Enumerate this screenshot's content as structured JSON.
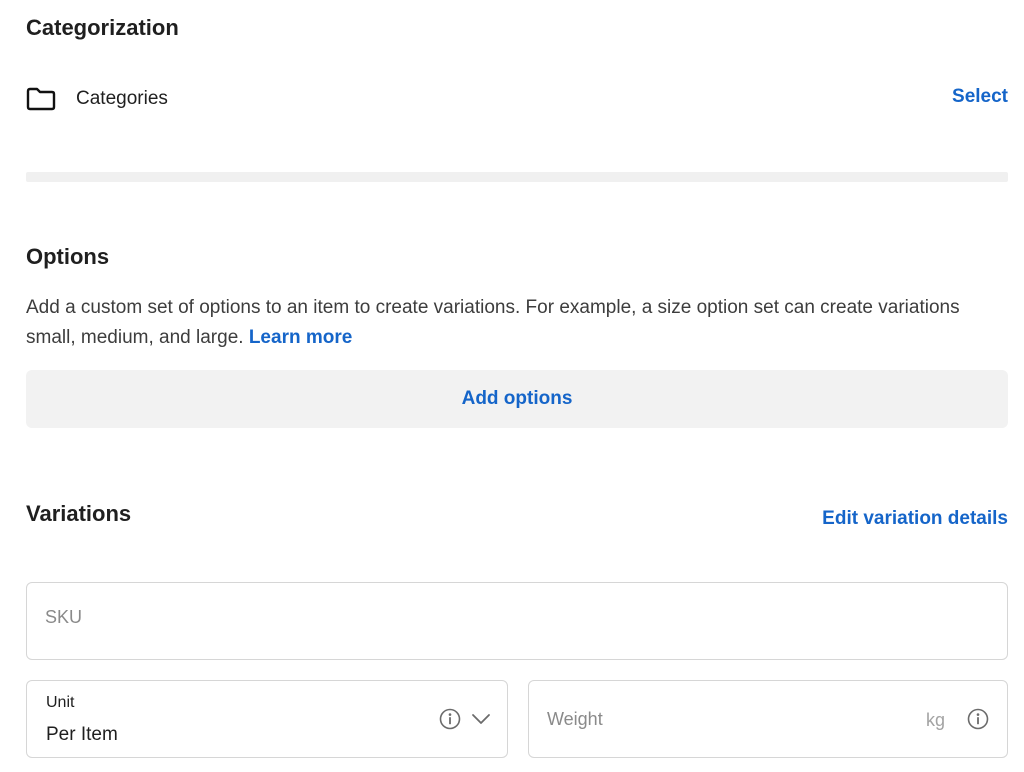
{
  "categorization": {
    "title": "Categorization",
    "icon": "folder-icon",
    "row_label": "Categories",
    "select_label": "Select"
  },
  "options": {
    "title": "Options",
    "description": "Add a custom set of options to an item to create variations. For example, a size option set can create variations small, medium, and large.",
    "learn_more_label": "Learn more",
    "add_button_label": "Add options"
  },
  "variations": {
    "title": "Variations",
    "edit_link_label": "Edit variation details",
    "sku": {
      "placeholder": "SKU",
      "value": ""
    },
    "unit": {
      "label": "Unit",
      "value": "Per Item",
      "icons": [
        "info-icon",
        "chevron-down-icon"
      ]
    },
    "weight": {
      "placeholder": "Weight",
      "value": "",
      "suffix": "kg",
      "icon": "info-icon"
    }
  },
  "colors": {
    "link": "#1565c9",
    "text": "#1f1f1f",
    "muted": "#8a8a8a",
    "border": "#d6d6d6",
    "button_bg": "#f2f2f2"
  }
}
